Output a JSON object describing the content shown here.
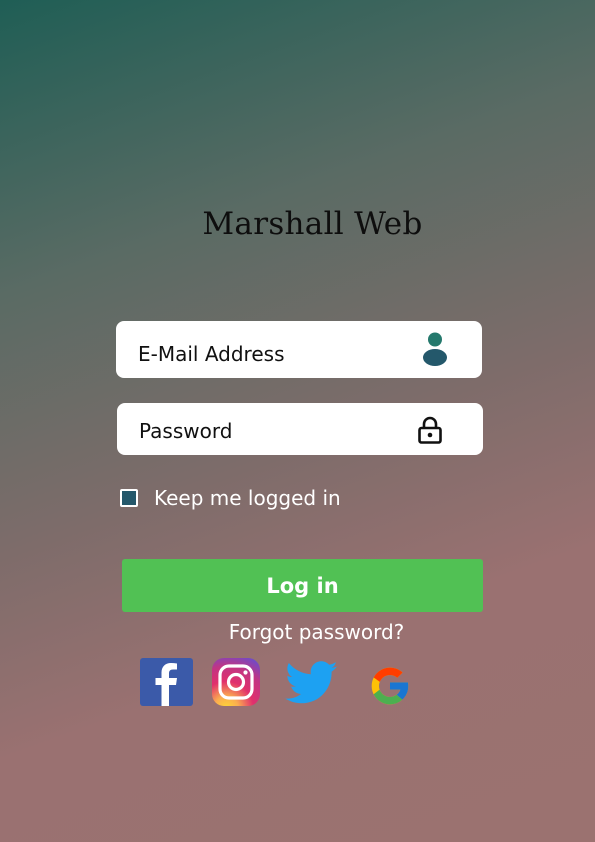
{
  "brand": {
    "name": "Marshall Web"
  },
  "login_form": {
    "email_placeholder": "E-Mail Address",
    "password_placeholder": "Password",
    "remember_label": "Keep me logged in",
    "remember_checked": true,
    "login_button_label": "Log in",
    "forgot_password_label": "Forgot password?"
  },
  "icons": {
    "email": "user-icon",
    "password": "lock-icon"
  },
  "social_logins": [
    {
      "icon": "facebook-icon"
    },
    {
      "icon": "instagram-icon"
    },
    {
      "icon": "twitter-icon"
    },
    {
      "icon": "google-icon"
    }
  ],
  "colors": {
    "login_button": "#51c154",
    "checkbox_fill": "#24586b",
    "user_icon": "#24586b",
    "facebook": "#3b5aa9",
    "twitter": "#1da1f2"
  }
}
